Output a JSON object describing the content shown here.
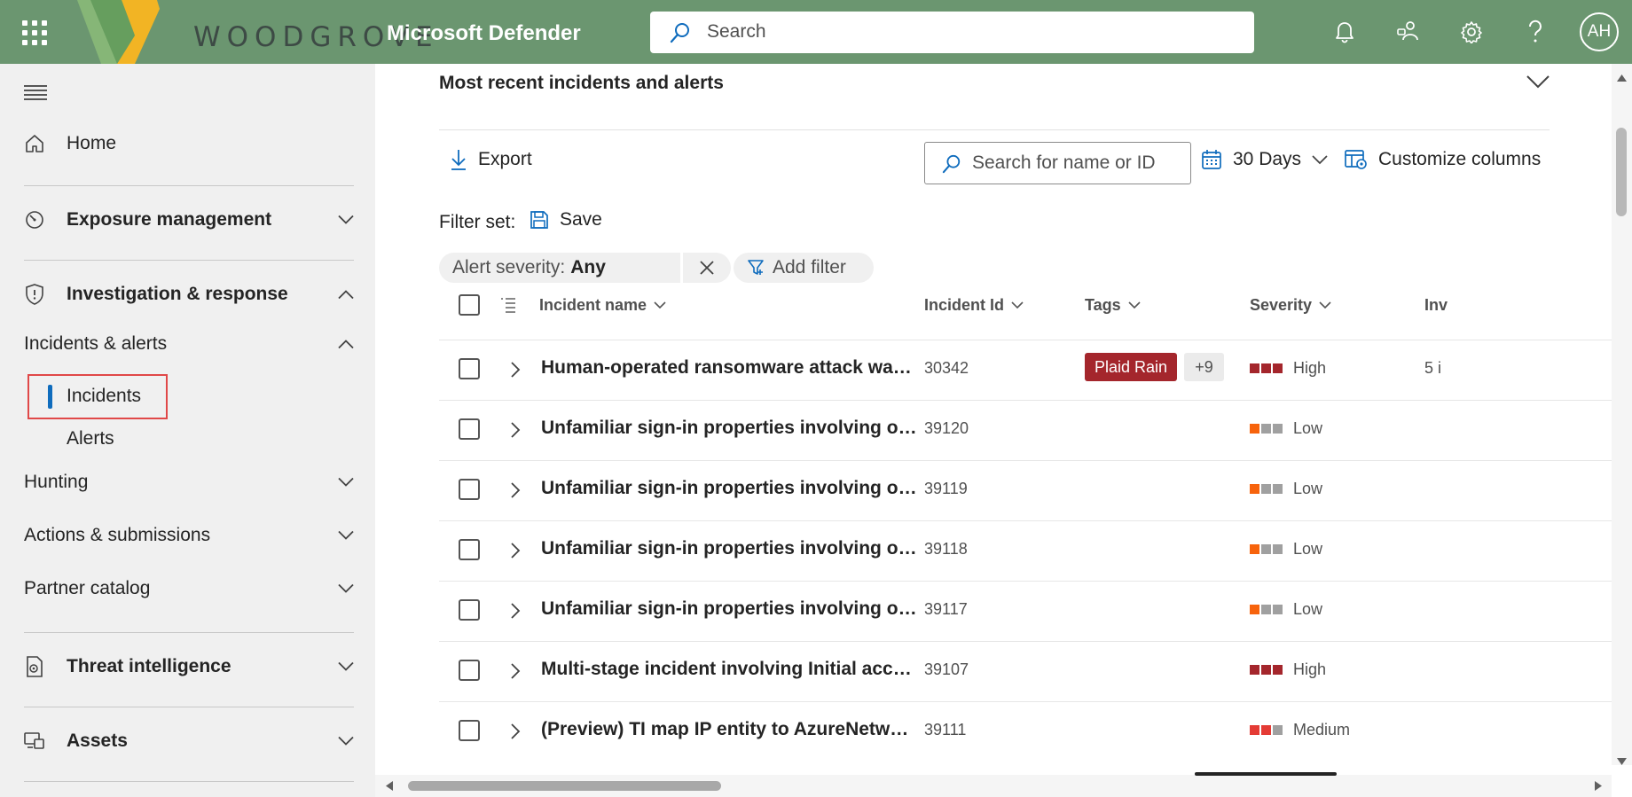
{
  "header": {
    "brand_logo_text": "WOODGROVE",
    "product_name": "Microsoft Defender",
    "search_placeholder": "Search",
    "user_initials": "AH",
    "accent_color": "#6b9670"
  },
  "sidebar": {
    "items": [
      {
        "label": "Home",
        "icon": "home-icon"
      },
      {
        "label": "Exposure management",
        "icon": "gauge-icon"
      },
      {
        "label": "Investigation & response",
        "icon": "shield-icon"
      },
      {
        "label": "Incidents & alerts"
      },
      {
        "label": "Incidents",
        "selected": true
      },
      {
        "label": "Alerts"
      },
      {
        "label": "Hunting"
      },
      {
        "label": "Actions & submissions"
      },
      {
        "label": "Partner catalog"
      },
      {
        "label": "Threat intelligence",
        "icon": "threat-intel-icon"
      },
      {
        "label": "Assets",
        "icon": "assets-icon"
      }
    ]
  },
  "main": {
    "section_title": "Most recent incidents and alerts",
    "toolbar": {
      "export_label": "Export",
      "search_placeholder": "Search for name or ID",
      "time_range_label": "30 Days",
      "customize_label": "Customize columns"
    },
    "filter_set": {
      "label": "Filter set:",
      "save_label": "Save",
      "severity_chip_label": "Alert severity:",
      "severity_chip_value": "Any",
      "add_filter_label": "Add filter"
    },
    "table": {
      "columns": [
        "Incident name",
        "Incident Id",
        "Tags",
        "Severity",
        "Inv"
      ],
      "rows": [
        {
          "name": "Human-operated ransomware attack was launched from a compromised asset",
          "id": "30342",
          "tag": "Plaid Rain",
          "more_tags": "+9",
          "severity": "High",
          "investigation": "5 i"
        },
        {
          "name": "Unfamiliar sign-in properties involving one user",
          "id": "39120",
          "severity": "Low"
        },
        {
          "name": "Unfamiliar sign-in properties involving one user",
          "id": "39119",
          "severity": "Low"
        },
        {
          "name": "Unfamiliar sign-in properties involving one user",
          "id": "39118",
          "severity": "Low"
        },
        {
          "name": "Unfamiliar sign-in properties involving one user",
          "id": "39117",
          "severity": "Low"
        },
        {
          "name": "Multi-stage incident involving Initial access & Credential access",
          "id": "39107",
          "severity": "High"
        },
        {
          "name": "(Preview) TI map IP entity to AzureNetworkAnalytics_CL",
          "id": "39111",
          "severity": "Medium"
        }
      ]
    },
    "severity_colors": {
      "high": "#a4262c",
      "low": "#f7630c",
      "medium": "#e43b35",
      "empty": "#a0a0a0"
    }
  }
}
